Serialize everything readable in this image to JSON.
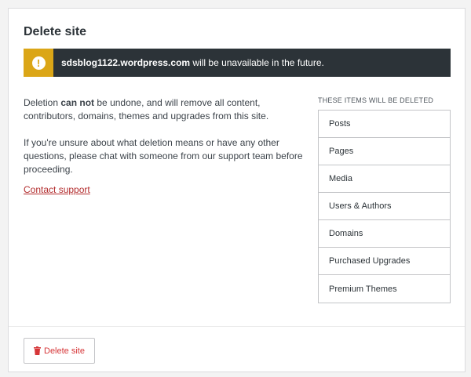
{
  "page": {
    "title": "Delete site"
  },
  "notice": {
    "domain": "sdsblog1122.wordpress.com",
    "message": " will be unavailable in the future.",
    "icon": "warning-icon",
    "icon_glyph": "!",
    "accent_color": "#dba617",
    "background_color": "#2c3338"
  },
  "description": {
    "p1_before": "Deletion ",
    "p1_bold": "can not",
    "p1_after": " be undone, and will remove all content, contributors, domains, themes and upgrades from this site.",
    "p2": "If you're unsure about what deletion means or have any other questions, please chat with someone from our support team before proceeding."
  },
  "contact_link": {
    "label": "Contact support",
    "color": "#b32d2e"
  },
  "items": {
    "header": "THESE ITEMS WILL BE DELETED",
    "list": [
      "Posts",
      "Pages",
      "Media",
      "Users & Authors",
      "Domains",
      "Purchased Upgrades",
      "Premium Themes"
    ]
  },
  "footer": {
    "delete_label": "Delete site",
    "delete_icon": "trash-icon",
    "delete_color": "#d63638"
  }
}
